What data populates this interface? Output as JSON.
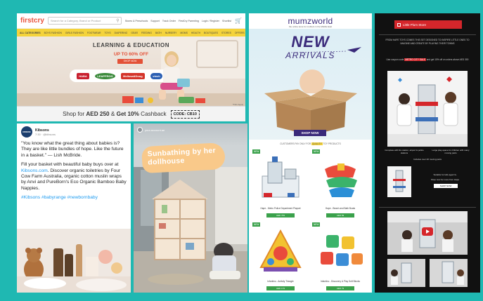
{
  "firstcry": {
    "logo": "firstcry",
    "search_placeholder": "Search for a Category, Brand or Product",
    "header_links": [
      "Stores & Preschools",
      "Support",
      "Track Order",
      "FirstCry Parenting",
      "Login / Register",
      "Shortlist"
    ],
    "nav_items": [
      "ALL CATEGORIES",
      "BOYS FASHION",
      "GIRLS FASHION",
      "FOOTWEAR",
      "TOYS",
      "DIAPERING",
      "GEAR",
      "FEEDING",
      "BATH",
      "NURSERY",
      "MOMS",
      "HEALTH",
      "BOUTIQUES",
      "STORES",
      "OFFERS"
    ],
    "hero_title": "LEARNING & EDUCATION",
    "hero_offer": "UP TO 60% OFF",
    "hero_button": "SHOP NOW",
    "brands": [
      "HABA",
      "LEAPFROG",
      "Melissa&Doug",
      "vtech"
    ],
    "tc_note": "*T&C Apply",
    "footer_prefix": "Shop for ",
    "footer_amount": "AED 250",
    "footer_mid": " & ",
    "footer_cashback": "Get 10%",
    "footer_suffix": " Cashback",
    "footer_code": "CODE: CB10"
  },
  "tweet": {
    "avatar_text": "KIBSONS",
    "name": "Kibsons",
    "handle": "7:30 · @kibsons",
    "para1": "\"You know what the great thing about babies is? They are like little bundles of hope. Like the future in a basket.\" — Lish McBride.",
    "para2_a": "Fill your basket with beautiful baby buys over at ",
    "para2_link": "Kibsons.com",
    "para2_b": ". Discover organic toiletries by Four Cow Farm Australia, organic cotton muslin wraps by Anvi and PureBorn's Eco Organic Bamboo Baby Nappies.",
    "hashtags": "#Kibsons #babyrange #newbornbaby"
  },
  "story": {
    "handle": "your.account.ae",
    "sticker": "Sunbathing by her dollhouse"
  },
  "mumzworld": {
    "logo": "mumzworld",
    "tagline": "the online store for mothers in the Middle East",
    "headline": "NEW",
    "subheadline": "ARRIVALS",
    "button": "SHOP NOW",
    "strip_a": "CUSTOMERS PAY ONLY FOR",
    "strip_hl": "QUALITY",
    "strip_b": "TOY PRODUCTS",
    "products": [
      {
        "badge": "NEW",
        "name": "Hape - Metro Police Department Playset",
        "price": "AED 769"
      },
      {
        "badge": "NEW",
        "name": "Hape - Beach and Bath Boats",
        "price": "AED 69"
      },
      {
        "badge": "NEW",
        "name": "Infantino - Activity Triangle",
        "price": "AED 179"
      },
      {
        "badge": "NEW",
        "name": "Infantino - Discovery & Play Soft Blocks",
        "price": "AED 79"
      }
    ]
  },
  "darkmail": {
    "logo": "Little Plum Store",
    "intro": "FROM HAPE TOYS COMES THIS SET DESIGNED TO INSPIRE LITTLE ONES TO IMAGINE AND CREATE BY PLAYING THEIR TOWNS",
    "promo_a": "Use coupon code",
    "promo_hl": "METRO CITY SALE",
    "promo_b": "and get 15% off on orders above AED 300",
    "cap1": "Complete with fire station, airport & police stations",
    "cap2": "Large play-space for children with many moving parts",
    "cap3": "Includes over 20 moving parts",
    "cap4": "Suitable for kids aged 3+",
    "cap5": "Shop now for more from Hape",
    "btn": "SHOP NOW"
  }
}
